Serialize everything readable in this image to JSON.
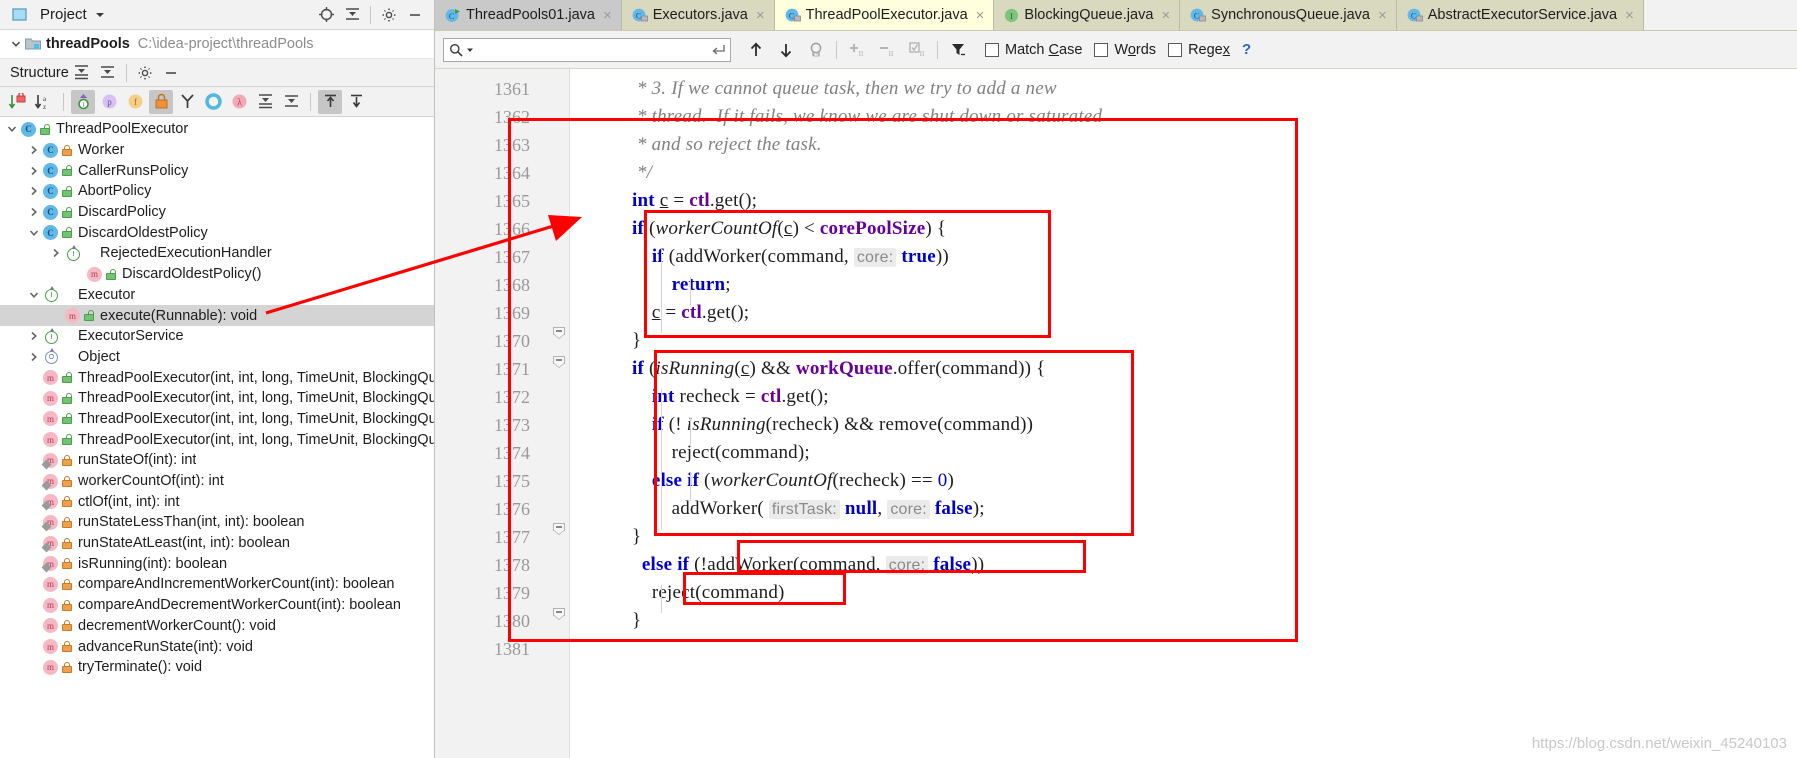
{
  "project_panel": {
    "title": "Project",
    "project_name": "threadPools",
    "project_path": "C:\\idea-project\\threadPools",
    "icons": [
      "locate-icon",
      "collapse-all-icon",
      "settings-icon",
      "minimize-icon"
    ]
  },
  "structure_panel": {
    "title": "Structure",
    "toolbar_icons": [
      "sort-by-visibility-icon",
      "sort-alphabetically-icon",
      "show-inherited-icon",
      "show-properties-icon",
      "show-fields-icon",
      "show-non-public-icon",
      "group-by-class-icon",
      "show-anonymous-icon",
      "show-lambdas-icon",
      "expand-all-icon",
      "collapse-all-icon",
      "autoscroll-to-source-icon",
      "autoscroll-from-source-icon"
    ],
    "tree": [
      {
        "label": "ThreadPoolExecutor",
        "depth": 0,
        "arrow": "down",
        "icon": "class-icon",
        "badge": "public",
        "selected": false
      },
      {
        "label": "Worker",
        "depth": 1,
        "arrow": "right",
        "icon": "class-icon",
        "badge": "private",
        "selected": false
      },
      {
        "label": "CallerRunsPolicy",
        "depth": 1,
        "arrow": "right",
        "icon": "class-icon",
        "badge": "public",
        "selected": false
      },
      {
        "label": "AbortPolicy",
        "depth": 1,
        "arrow": "right",
        "icon": "class-icon",
        "badge": "public",
        "selected": false
      },
      {
        "label": "DiscardPolicy",
        "depth": 1,
        "arrow": "right",
        "icon": "class-icon",
        "badge": "public",
        "selected": false
      },
      {
        "label": "DiscardOldestPolicy",
        "depth": 1,
        "arrow": "down",
        "icon": "class-icon",
        "badge": "public",
        "selected": false
      },
      {
        "label": "RejectedExecutionHandler",
        "depth": 2,
        "arrow": "right",
        "icon": "interface-icon",
        "badge": "none",
        "selected": false
      },
      {
        "label": "DiscardOldestPolicy()",
        "depth": 3,
        "arrow": "none",
        "icon": "method-icon",
        "badge": "public",
        "selected": false
      },
      {
        "label": "Executor",
        "depth": 1,
        "arrow": "down",
        "icon": "interface-icon",
        "badge": "none",
        "selected": false
      },
      {
        "label": "execute(Runnable): void",
        "depth": 2,
        "arrow": "none",
        "icon": "method-icon",
        "badge": "public",
        "selected": true
      },
      {
        "label": "ExecutorService",
        "depth": 1,
        "arrow": "right",
        "icon": "interface-icon",
        "badge": "none",
        "selected": false
      },
      {
        "label": "Object",
        "depth": 1,
        "arrow": "right",
        "icon": "object-icon",
        "badge": "none",
        "selected": false
      },
      {
        "label": "ThreadPoolExecutor(int, int, long, TimeUnit, BlockingQu",
        "depth": 1,
        "arrow": "none",
        "icon": "method-icon",
        "badge": "public",
        "selected": false
      },
      {
        "label": "ThreadPoolExecutor(int, int, long, TimeUnit, BlockingQu",
        "depth": 1,
        "arrow": "none",
        "icon": "method-icon",
        "badge": "public",
        "selected": false
      },
      {
        "label": "ThreadPoolExecutor(int, int, long, TimeUnit, BlockingQu",
        "depth": 1,
        "arrow": "none",
        "icon": "method-icon",
        "badge": "public",
        "selected": false
      },
      {
        "label": "ThreadPoolExecutor(int, int, long, TimeUnit, BlockingQu",
        "depth": 1,
        "arrow": "none",
        "icon": "method-icon",
        "badge": "public",
        "selected": false
      },
      {
        "label": "runStateOf(int): int",
        "depth": 1,
        "arrow": "none",
        "icon": "method-static-icon",
        "badge": "private",
        "selected": false
      },
      {
        "label": "workerCountOf(int): int",
        "depth": 1,
        "arrow": "none",
        "icon": "method-static-icon",
        "badge": "private",
        "selected": false
      },
      {
        "label": "ctlOf(int, int): int",
        "depth": 1,
        "arrow": "none",
        "icon": "method-static-icon",
        "badge": "private",
        "selected": false
      },
      {
        "label": "runStateLessThan(int, int): boolean",
        "depth": 1,
        "arrow": "none",
        "icon": "method-static-icon",
        "badge": "private",
        "selected": false
      },
      {
        "label": "runStateAtLeast(int, int): boolean",
        "depth": 1,
        "arrow": "none",
        "icon": "method-static-icon",
        "badge": "private",
        "selected": false
      },
      {
        "label": "isRunning(int): boolean",
        "depth": 1,
        "arrow": "none",
        "icon": "method-static-icon",
        "badge": "private",
        "selected": false
      },
      {
        "label": "compareAndIncrementWorkerCount(int): boolean",
        "depth": 1,
        "arrow": "none",
        "icon": "method-icon",
        "badge": "private",
        "selected": false
      },
      {
        "label": "compareAndDecrementWorkerCount(int): boolean",
        "depth": 1,
        "arrow": "none",
        "icon": "method-icon",
        "badge": "private",
        "selected": false
      },
      {
        "label": "decrementWorkerCount(): void",
        "depth": 1,
        "arrow": "none",
        "icon": "method-icon",
        "badge": "private",
        "selected": false
      },
      {
        "label": "advanceRunState(int): void",
        "depth": 1,
        "arrow": "none",
        "icon": "method-icon",
        "badge": "private",
        "selected": false
      },
      {
        "label": "tryTerminate(): void",
        "depth": 1,
        "arrow": "none",
        "icon": "method-icon",
        "badge": "private",
        "selected": false
      }
    ]
  },
  "editor_tabs": [
    {
      "label": "ThreadPools01.java",
      "icon": "java-runnable-class-icon",
      "state": "gray",
      "close": "×"
    },
    {
      "label": "Executors.java",
      "icon": "java-class-icon",
      "state": "olive",
      "close": "×"
    },
    {
      "label": "ThreadPoolExecutor.java",
      "icon": "java-class-icon",
      "state": "active",
      "close": "×"
    },
    {
      "label": "BlockingQueue.java",
      "icon": "java-interface-icon",
      "state": "olive",
      "close": "×"
    },
    {
      "label": "SynchronousQueue.java",
      "icon": "java-class-icon",
      "state": "olive",
      "close": "×"
    },
    {
      "label": "AbstractExecutorService.java",
      "icon": "java-class-icon",
      "state": "olive",
      "close": "×"
    }
  ],
  "find_toolbar": {
    "search_value": "",
    "search_placeholder": "",
    "search_icon": "magnifier-icon",
    "dropdown_icon": "chevron-down-icon",
    "enter_icon": "return-arrow-icon",
    "buttons": [
      "find-previous-icon",
      "find-next-icon",
      "select-all-occurrences-icon",
      "add-selection-icon",
      "remove-selection-icon",
      "select-all-icon",
      "filter-icon"
    ],
    "checkboxes": [
      {
        "label_pre": "Match ",
        "label_mnemonic": "C",
        "label_post": "ase",
        "checked": false
      },
      {
        "label_pre": "W",
        "label_mnemonic": "o",
        "label_post": "rds",
        "checked": false
      },
      {
        "label_pre": "Rege",
        "label_mnemonic": "x",
        "label_post": "",
        "checked": false
      }
    ],
    "help": "?"
  },
  "editor": {
    "line_numbers": [
      "1361",
      "1362",
      "1363",
      "1364",
      "1365",
      "1366",
      "1367",
      "1368",
      "1369",
      "1370",
      "1371",
      "1372",
      "1373",
      "1374",
      "1375",
      "1376",
      "1377",
      "1378",
      "1379",
      "1380",
      "1381"
    ],
    "code_lines": [
      " * 3. If we cannot queue task, then we try to add a new",
      " * thread.  If it fails, we know we are shut down or saturated",
      " * and so reject the task.",
      " */",
      "int c = ctl.get();",
      "if (workerCountOf(c) < corePoolSize) {",
      "    if (addWorker(command,  core: true))",
      "        return;",
      "    c = ctl.get();",
      "}",
      "if (isRunning(c) && workQueue.offer(command)) {",
      "    int recheck = ctl.get();",
      "    if (! isRunning(recheck) && remove(command))",
      "        reject(command);",
      "    else if (workerCountOf(recheck) == 0)",
      "        addWorker( firstTask: null,  core: false);",
      "}",
      "else if (!addWorker(command,  core: false))",
      "    reject(command)",
      "}",
      ""
    ]
  },
  "annotations": {
    "watermark": "https://blog.csdn.net/weixin_45240103",
    "box_color": "#ff0000",
    "arrow_from": "execute(Runnable): void",
    "boxes": [
      "outer-highlight-box",
      "core-pool-branch-box",
      "work-queue-branch-box",
      "add-worker-else-box",
      "reject-command-box"
    ]
  }
}
